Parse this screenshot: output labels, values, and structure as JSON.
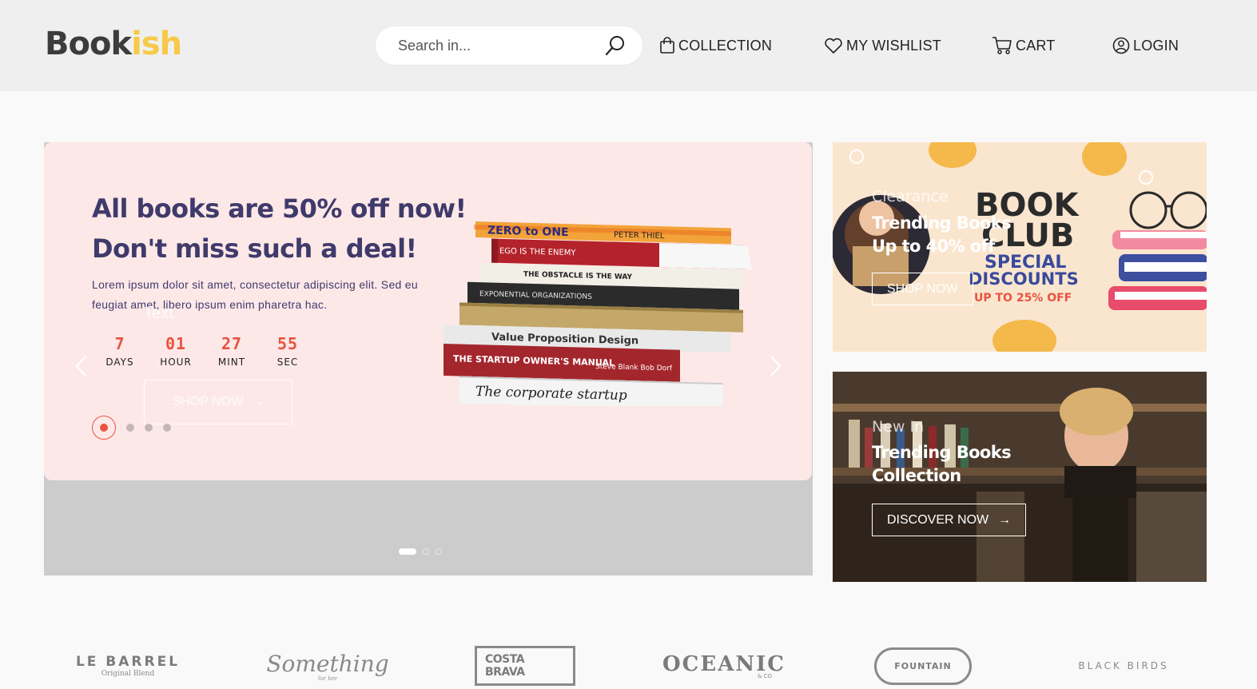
{
  "header": {
    "logo_part1": "Book",
    "logo_part2": "ish",
    "search_placeholder": "Search in...",
    "nav": [
      {
        "label": "COLLECTION",
        "icon": "bag-icon"
      },
      {
        "label": "MY WISHLIST",
        "icon": "heart-icon"
      },
      {
        "label": "CART",
        "icon": "cart-icon"
      },
      {
        "label": "LOGIN",
        "icon": "user-icon"
      }
    ]
  },
  "hero": {
    "title_line1": "All books are 50% off now!",
    "title_line2": "Don't miss such a deal!",
    "description": "Lorem ipsum dolor sit amet, consectetur adipiscing elit. Sed eu feugiat amet, libero ipsum enim pharetra hac.",
    "ghost_text": "Text",
    "countdown": [
      {
        "value": "7",
        "label": "DAYS"
      },
      {
        "value": "01",
        "label": "HOUR"
      },
      {
        "value": "27",
        "label": "MINT"
      },
      {
        "value": "55",
        "label": "SEC"
      }
    ],
    "shop_button": "SHOP NOW",
    "book_titles": [
      "ZERO to ONE",
      "PETER THIEL",
      "EGO IS THE ENEMY",
      "THE OBSTACLE IS THE WAY",
      "EXPONENTIAL ORGANIZATIONS",
      "Value Proposition Design",
      "THE STARTUP OWNER'S MANUAL",
      "Steve Blank Bob Dorf",
      "The corporate startup"
    ]
  },
  "banner1": {
    "kicker": "Clearance",
    "title_line1": "Trending Books",
    "title_line2": "Up to 40% off",
    "button": "SHOP NOW",
    "art_title_1": "BOOK",
    "art_title_2": "CLUB",
    "art_sub_1": "SPECIAL",
    "art_sub_2": "DISCOUNTS",
    "art_sub_3": "UP TO 25% OFF"
  },
  "banner2": {
    "kicker": "New In",
    "title_line1": "Trending Books",
    "title_line2": "Collection",
    "button": "DISCOVER NOW"
  },
  "brands": [
    {
      "name": "LE BARREL",
      "sub": "Original Blend"
    },
    {
      "name": "Something",
      "sub": "for her"
    },
    {
      "name": "COSTA BRAVA"
    },
    {
      "name": "OCEANIC",
      "sub": "& CO"
    },
    {
      "name": "FOUNTAIN"
    },
    {
      "name": "BLACK BIRDS"
    }
  ]
}
